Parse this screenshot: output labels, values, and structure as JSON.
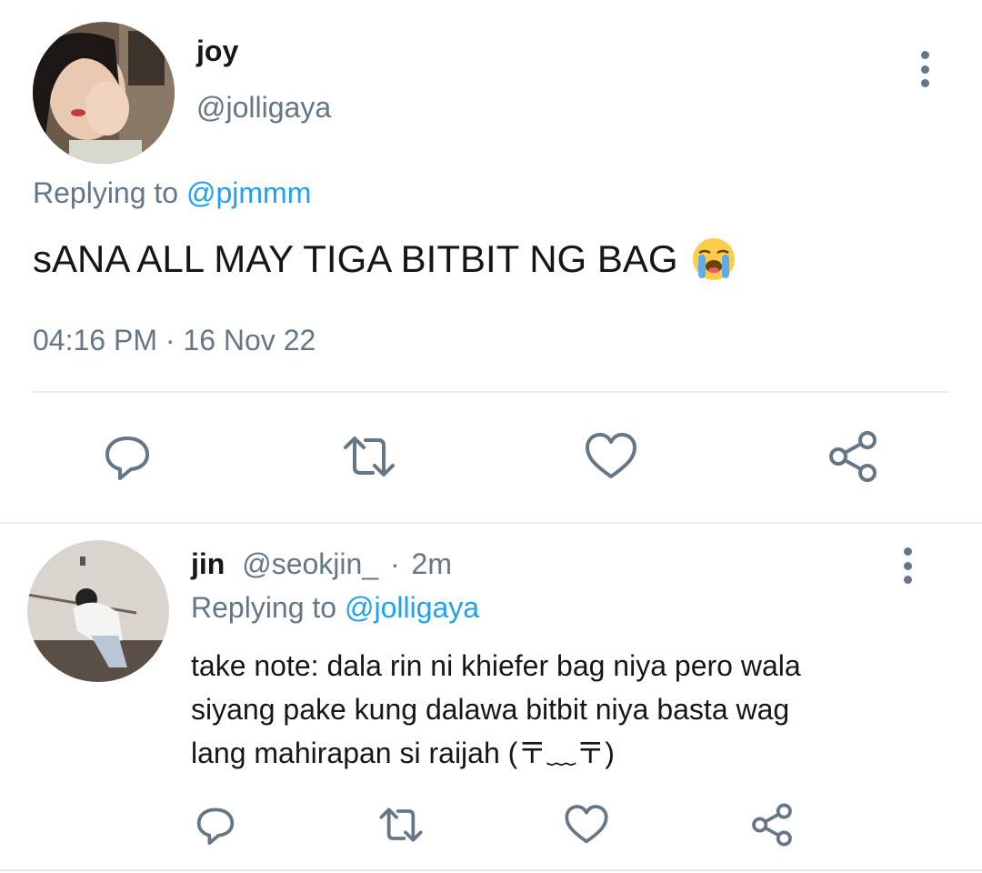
{
  "tweet": {
    "author_name": "joy",
    "author_handle": "@jolligaya",
    "replying_prefix": "Replying to",
    "replying_to": "@pjmmm",
    "text": "sANA ALL MAY TIGA BITBIT NG BAG",
    "text_emoji": "loudly-crying-face-emoji",
    "time": "04:16 PM",
    "separator": "·",
    "date": "16 Nov 22"
  },
  "reply": {
    "author_name": "jin",
    "author_handle": "@seokjin_",
    "separator": "·",
    "age": "2m",
    "replying_prefix": "Replying to",
    "replying_to": "@jolligaya",
    "text_lines": [
      "take note: dala rin ni khiefer bag niya pero wala",
      "siyang pake kung dalawa bitbit niya basta wag",
      "lang mahirapan si raijah (〒﹏〒)"
    ]
  },
  "actions": [
    "reply-icon",
    "retweet-icon",
    "like-icon",
    "share-icon"
  ],
  "colors": {
    "text": "#14171a",
    "secondary": "#657786",
    "link": "#1da1f2",
    "divider": "#e6ecf0"
  }
}
